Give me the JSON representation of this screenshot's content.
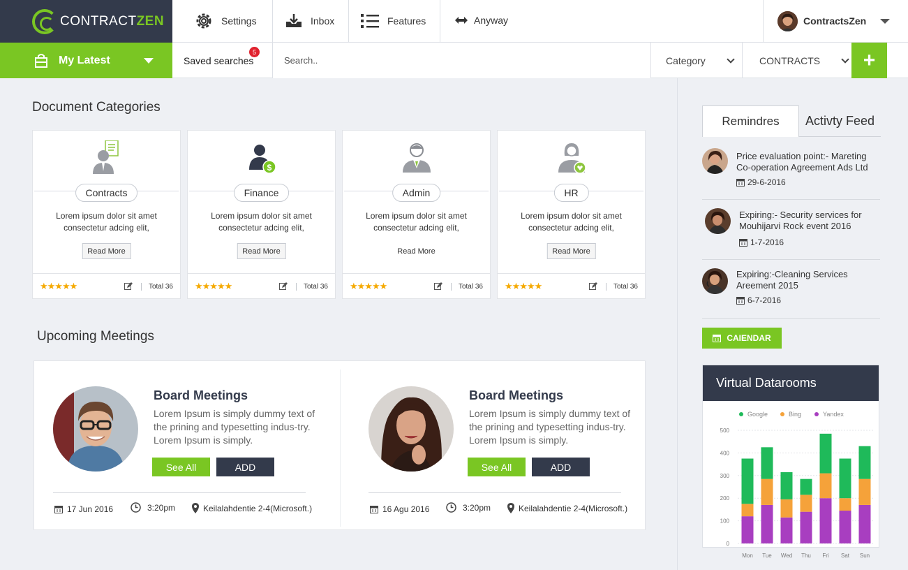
{
  "brand": {
    "name_part1": "CONTRACT",
    "name_part2": "ZEN"
  },
  "topnav": {
    "settings": "Settings",
    "inbox": "Inbox",
    "features": "Features",
    "anyway": "Anyway"
  },
  "profile": {
    "name": "ContractsZen"
  },
  "subbar": {
    "my_latest": "My Latest",
    "saved_searches": "Saved searches",
    "saved_count": "5",
    "search_placeholder": "Search..",
    "category": "Category",
    "contracts": "CONTRACTS",
    "add": "+"
  },
  "document_categories": {
    "title": "Document Categories",
    "cards": [
      {
        "name": "Contracts",
        "desc": "Lorem ipsum dolor sit amet consectetur adcing elit,",
        "read_more": "Read More",
        "stars": "★★★★★",
        "total": "Total 36"
      },
      {
        "name": "Finance",
        "desc": "Lorem ipsum dolor sit amet consectetur adcing elit,",
        "read_more": "Read More",
        "stars": "★★★★★",
        "total": "Total 36"
      },
      {
        "name": "Admin",
        "desc": "Lorem ipsum dolor sit amet consectetur adcing elit,",
        "read_more": "Read More",
        "stars": "★★★★★",
        "total": "Total 36"
      },
      {
        "name": "HR",
        "desc": "Lorem ipsum dolor sit amet consectetur adcing elit,",
        "read_more": "Read More",
        "stars": "★★★★★",
        "total": "Total 36"
      }
    ]
  },
  "upcoming_meetings": {
    "title": "Upcoming Meetings",
    "items": [
      {
        "title": "Board Meetings",
        "desc": "Lorem Ipsum is simply dummy text of the prining and typesetting indus-try. Lorem  Ipsum is simply.",
        "see_all": "See All",
        "add": "ADD",
        "date": "17 Jun 2016",
        "time": "3:20pm",
        "location": "Keilalahdentie 2-4(Microsoft.)"
      },
      {
        "title": "Board Meetings",
        "desc": "Lorem Ipsum is simply dummy text of the prining and typesetting indus-try. Lorem  Ipsum is simply.",
        "see_all": "See All",
        "add": "ADD",
        "date": "16 Agu 2016",
        "time": "3:20pm",
        "location": "Keilalahdentie 2-4(Microsoft.)"
      }
    ]
  },
  "right": {
    "tabs": {
      "reminders": "Remindres",
      "activity": "Activty Feed"
    },
    "reminders": [
      {
        "text": "Price evaluation point:- Mareting Co-operation Agreement Ads Ltd",
        "date": "29-6-2016"
      },
      {
        "text": "Expiring:- Security services for Mouhijarvi Rock event 2016",
        "date": "1-7-2016"
      },
      {
        "text": "Expiring:-Cleaning Services Areement 2015",
        "date": "6-7-2016"
      }
    ],
    "calendar_button": "CAIENDAR",
    "datarooms_title": "Virtual Datarooms"
  },
  "chart_data": {
    "type": "bar",
    "stacked": true,
    "categories": [
      "Mon",
      "Tue",
      "Wed",
      "Thu",
      "Fri",
      "Sat",
      "Sun"
    ],
    "series": [
      {
        "name": "Yandex",
        "color": "#a83ec0",
        "values": [
          120,
          170,
          115,
          140,
          200,
          145,
          170
        ]
      },
      {
        "name": "Bing",
        "color": "#f5a23a",
        "values": [
          55,
          115,
          80,
          75,
          110,
          55,
          115
        ]
      },
      {
        "name": "Google",
        "color": "#1fba5a",
        "values": [
          200,
          140,
          120,
          70,
          175,
          175,
          145
        ]
      }
    ],
    "yticks": [
      0,
      100,
      200,
      300,
      400,
      500
    ],
    "ylim": [
      0,
      500
    ],
    "legend_order": [
      "Google",
      "Bing",
      "Yandex"
    ],
    "legend_position": "top"
  }
}
